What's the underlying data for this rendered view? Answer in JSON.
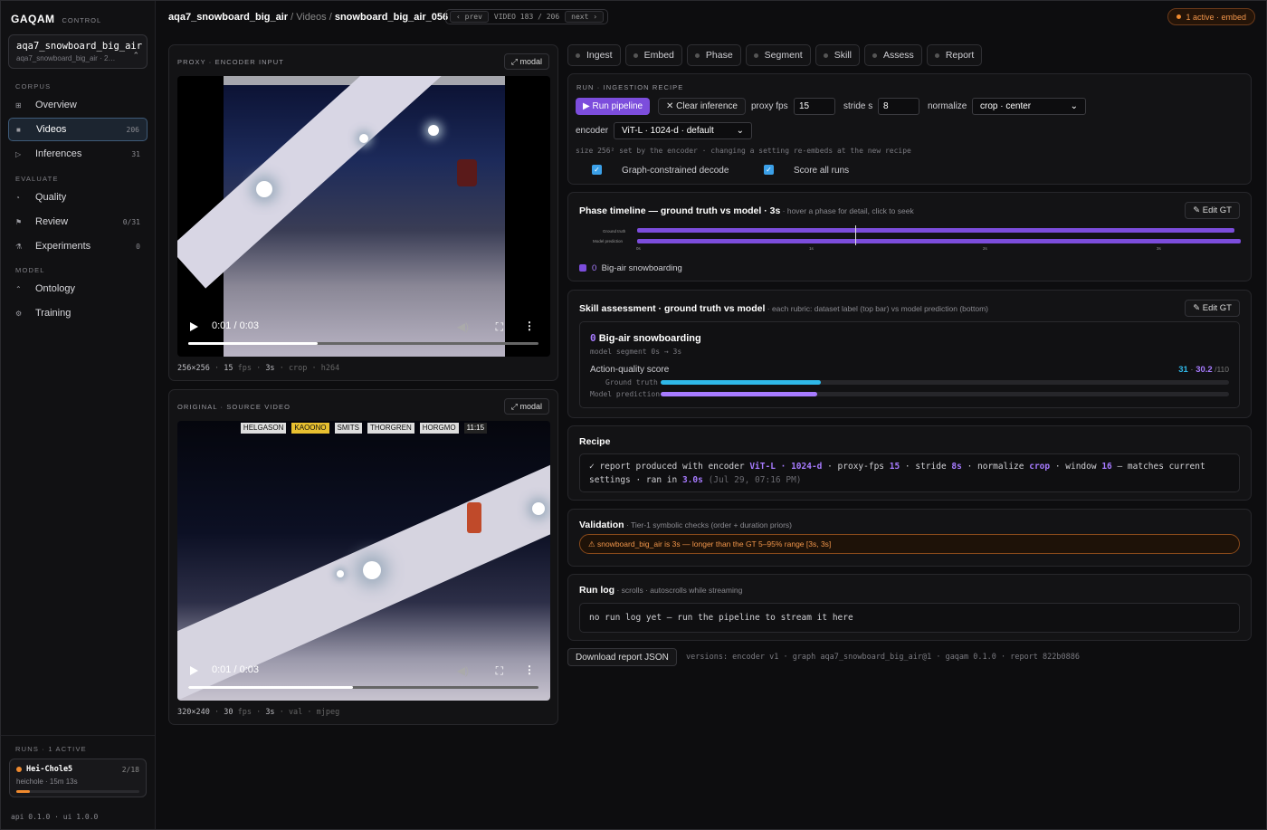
{
  "brand": {
    "name": "GAQAM",
    "sub": "CONTROL"
  },
  "project": {
    "name": "aqa7_snowboard_big_air",
    "sub": "aqa7_snowboard_big_air · 2…"
  },
  "sidebar": {
    "sec_corpus": "CORPUS",
    "sec_evaluate": "EVALUATE",
    "sec_model": "MODEL",
    "items": [
      {
        "label": "Overview",
        "count": "",
        "icon": "⊞"
      },
      {
        "label": "Videos",
        "count": "206",
        "icon": "■"
      },
      {
        "label": "Inferences",
        "count": "31",
        "icon": "▷"
      },
      {
        "label": "Quality",
        "count": "",
        "icon": "◔"
      },
      {
        "label": "Review",
        "count": "0/31",
        "icon": "⚑"
      },
      {
        "label": "Experiments",
        "count": "0",
        "icon": "⚗"
      },
      {
        "label": "Ontology",
        "count": "",
        "icon": "⌃"
      },
      {
        "label": "Training",
        "count": "",
        "icon": "⚙"
      }
    ],
    "runs_title": "RUNS · 1 ACTIVE",
    "run": {
      "name": "Hei-Chole5",
      "count": "2/18",
      "sub": "heichole · 15m 13s",
      "progress": 0.11
    },
    "version": "api 0.1.0 · ui 1.0.0"
  },
  "breadcrumb": {
    "project": "aqa7_snowboard_big_air",
    "sep1": " / ",
    "section": "Videos",
    "sep2": " / ",
    "item": "snowboard_big_air_056"
  },
  "pager": {
    "prev": "‹ prev",
    "label": "VIDEO 183 / 206",
    "next": "next ›"
  },
  "active_badge": "1 active · embed",
  "proxy": {
    "title": "PROXY · ENCODER INPUT",
    "modal": "⤢ modal",
    "time": "0:01 / 0:03",
    "progress": 0.37,
    "meta": [
      "256×256",
      "15",
      "fps",
      "3s",
      "crop",
      "h264"
    ]
  },
  "original": {
    "title": "ORIGINAL · SOURCE VIDEO",
    "modal": "⤢ modal",
    "time": "0:01 / 0:03",
    "progress": 0.47,
    "meta": [
      "320×240",
      "30",
      "fps",
      "3s",
      "val",
      "mjpeg"
    ],
    "scoreboard": [
      "HELGASON",
      "KAOONO",
      "SMITS",
      "THORGREN",
      "HORGMO"
    ],
    "clock": "11:15"
  },
  "tabs": [
    "Ingest",
    "Embed",
    "Phase",
    "Segment",
    "Skill",
    "Assess",
    "Report"
  ],
  "recipe_panel": {
    "title": "RUN · INGESTION RECIPE",
    "run_btn": "▶ Run pipeline",
    "clear_btn": "✕ Clear inference",
    "proxy_fps_label": "proxy fps",
    "proxy_fps": "15",
    "stride_label": "stride s",
    "stride": "8",
    "normalize_label": "normalize",
    "normalize": "crop · center",
    "encoder_label": "encoder",
    "encoder": "ViT-L · 1024-d · default",
    "note": "size 256² set by the encoder · changing a setting re-embeds at the new recipe",
    "chk1": "Graph-constrained decode",
    "chk2": "Score all runs"
  },
  "phase": {
    "title": "Phase timeline — ground truth vs model · 3s",
    "sub": " · hover a phase for detail, click to seek",
    "edit": "✎ Edit GT",
    "row1": "Ground truth",
    "row2": "Model prediction",
    "ticks": [
      "0s",
      "1s",
      "2s",
      "3s"
    ],
    "legend_idx": "0",
    "legend": "Big-air snowboarding"
  },
  "skill": {
    "title": "Skill assessment · ground truth vs model",
    "sub": " · each rubric: dataset label (top bar) vs model prediction (bottom)",
    "edit": "✎ Edit GT",
    "idx": "0",
    "name": "Big-air snowboarding",
    "segment": "model segment 0s → 3s",
    "score_label": "Action-quality score",
    "gt_val": "31",
    "sep": " · ",
    "pred_val": "30.2",
    "max": " /110",
    "gt_label": "Ground truth",
    "pred_label": "Model prediction",
    "gt_frac": 0.282,
    "pred_frac": 0.275
  },
  "recipe": {
    "title": "Recipe",
    "line": {
      "a": "✓ report produced with encoder ",
      "enc": "ViT-L · 1024-d",
      "b": " · proxy-fps ",
      "fps": "15",
      "c": " · stride ",
      "stride": "8s",
      "d": " · normalize ",
      "norm": "crop",
      "e": " · window ",
      "win": "16",
      "f": " — matches current settings · ran in ",
      "ran": "3.0s",
      "g": " (Jul 29, 07:16 PM)"
    }
  },
  "validation": {
    "title": "Validation",
    "sub": " · Tier-1 symbolic checks (order + duration priors)",
    "warn": "⚠ snowboard_big_air is 3s — longer than the GT 5–95% range [3s, 3s]"
  },
  "runlog": {
    "title": "Run log",
    "sub": " · scrolls · autoscrolls while streaming",
    "empty": "no run log yet — run the pipeline to stream it here"
  },
  "footer": {
    "download": "Download report JSON",
    "versions": "versions: encoder v1 · graph aqa7_snowboard_big_air@1 · gaqam 0.1.0 · report 822b0886"
  },
  "colors": {
    "accent": "#7c4ddc",
    "cyan": "#2fb8e8",
    "orange": "#f08a2e"
  }
}
